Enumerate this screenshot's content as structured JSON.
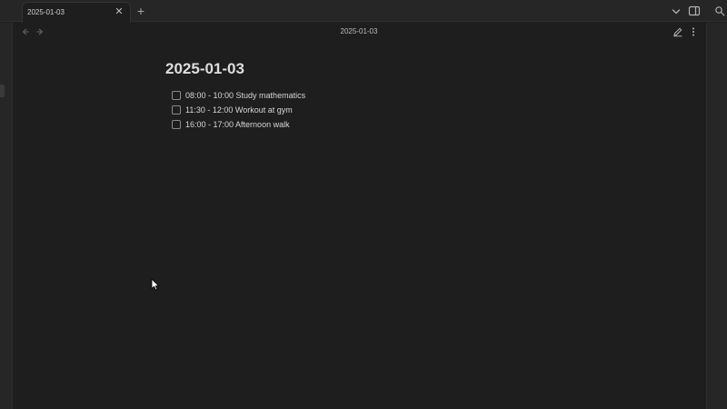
{
  "tabs": [
    {
      "title": "2025-01-03",
      "active": true
    }
  ],
  "tabbar": {
    "new_tab_icon": "plus-icon",
    "tab_list_icon": "chevron-down-icon",
    "sidebar_toggle_icon": "sidebar-toggle-icon",
    "right_ribbon_icon": "gear-search-icon"
  },
  "view_header": {
    "title": "2025-01-03",
    "back_icon": "arrow-left-icon",
    "forward_icon": "arrow-right-icon",
    "edit_icon": "pencil-icon",
    "more_icon": "more-vertical-icon"
  },
  "note": {
    "title": "2025-01-03",
    "tasks": [
      {
        "text": "08:00 - 10:00 Study mathematics",
        "checked": false
      },
      {
        "text": "11:30 - 12:00 Workout at gym",
        "checked": false
      },
      {
        "text": "16:00 - 17:00 Afternoon walk",
        "checked": false
      }
    ]
  },
  "colors": {
    "background": "#1e1e1e",
    "chrome": "#262626",
    "text": "#dadada",
    "muted": "#5d5d5d"
  }
}
